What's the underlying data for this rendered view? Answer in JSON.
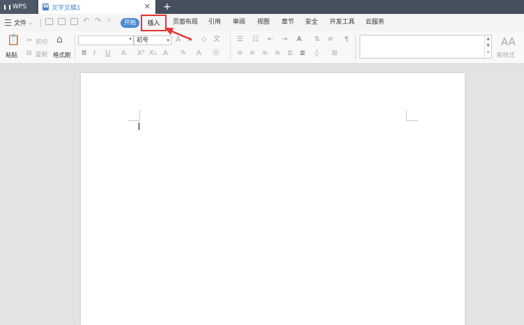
{
  "titlebar": {
    "app_name": "WPS",
    "doc_tab_title": "文字文稿1",
    "close_glyph": "✕",
    "new_tab_glyph": "+"
  },
  "menubar": {
    "file_label": "文件",
    "tabs": [
      "开始",
      "插入",
      "页面布局",
      "引用",
      "审阅",
      "视图",
      "章节",
      "安全",
      "开发工具",
      "云服务"
    ],
    "active_tab": "开始",
    "highlighted_tab": "插入"
  },
  "ribbon": {
    "paste": "粘贴",
    "cut": "剪切",
    "copy": "复制",
    "format_painter": "格式刷",
    "font_size": "初号",
    "new_style": "新样式"
  },
  "colors": {
    "titlebar_bg": "#454f5d",
    "accent_blue": "#4a8ad4",
    "highlight_red": "#e53333"
  }
}
